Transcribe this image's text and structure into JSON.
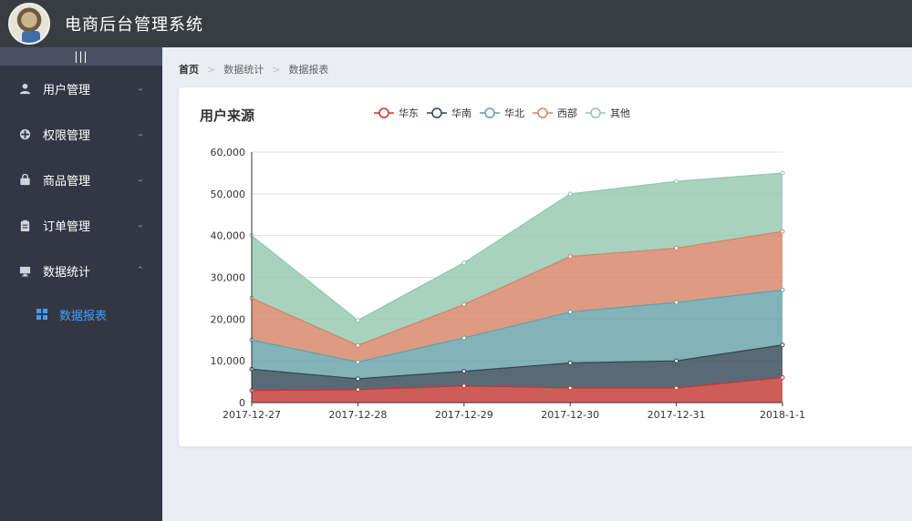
{
  "app": {
    "title": "电商后台管理系统",
    "toggle_label": "|||"
  },
  "sidebar": {
    "items": [
      {
        "label": "用户管理",
        "icon": "user-icon"
      },
      {
        "label": "权限管理",
        "icon": "permission-icon"
      },
      {
        "label": "商品管理",
        "icon": "bag-icon"
      },
      {
        "label": "订单管理",
        "icon": "clipboard-icon"
      },
      {
        "label": "数据统计",
        "icon": "monitor-icon",
        "expanded": true
      }
    ],
    "submenu": [
      {
        "label": "数据报表",
        "icon": "grid-icon",
        "active": true
      }
    ],
    "active_color": "#409eff"
  },
  "breadcrumb": [
    "首页",
    "数据统计",
    "数据报表"
  ],
  "chart_data": {
    "type": "area",
    "stacked": true,
    "title": "用户来源",
    "x": [
      "2017-12-27",
      "2017-12-28",
      "2017-12-29",
      "2017-12-30",
      "2017-12-31",
      "2018-1-1"
    ],
    "ylim": [
      0,
      60000
    ],
    "yticks": [
      "0",
      "10,000",
      "20,000",
      "30,000",
      "40,000",
      "50,000",
      "60,000"
    ],
    "grid": true,
    "legend_position": "top",
    "series": [
      {
        "name": "华东",
        "color": "#c23531",
        "values": [
          2900,
          3100,
          4000,
          3500,
          3500,
          6000
        ]
      },
      {
        "name": "华南",
        "color": "#2f4554",
        "values": [
          5100,
          2600,
          3500,
          6000,
          6500,
          7800
        ]
      },
      {
        "name": "华北",
        "color": "#61a0a8",
        "values": [
          7000,
          4000,
          8000,
          12200,
          14000,
          13200
        ]
      },
      {
        "name": "西部",
        "color": "#d48265",
        "values": [
          10000,
          4000,
          8000,
          13300,
          13000,
          14000
        ]
      },
      {
        "name": "其他",
        "color": "#91c7ae",
        "values": [
          15000,
          6000,
          10000,
          15000,
          16000,
          14000
        ]
      }
    ]
  }
}
